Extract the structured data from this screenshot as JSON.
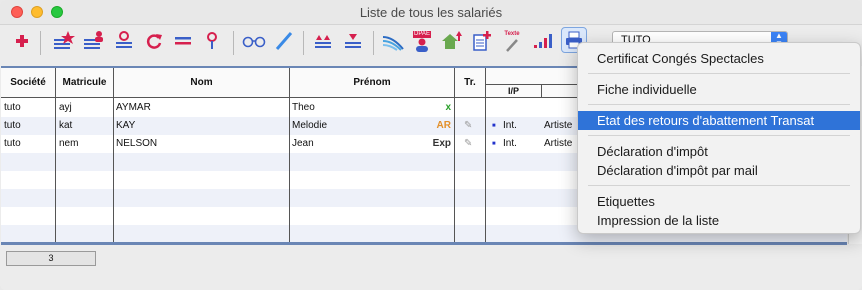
{
  "window": {
    "title": "Liste de tous les salariés"
  },
  "toolbar": {
    "company_select": "TUTO",
    "dpae_badge": "DPAE",
    "texte_badge": "Texte",
    "icons": [
      "add-icon",
      "add-star-list-icon",
      "add-person-list-icon",
      "tree-person-icon",
      "refresh-icon",
      "equal-lines-icon",
      "search-key-icon",
      "glasses-icon",
      "pen-icon",
      "sort-up-icon",
      "sort-down-icon",
      "swoosh-icon",
      "dpae-person-icon",
      "home-up-icon",
      "doc-plus-icon",
      "text-pen-icon",
      "bars-icon",
      "print-icon"
    ]
  },
  "table": {
    "headers": {
      "societe": "Société",
      "matricule": "Matricule",
      "nom": "Nom",
      "prenom": "Prénom",
      "tr": "Tr.",
      "ip": "I/P"
    },
    "rows": [
      {
        "societe": "tuto",
        "matricule": "ayj",
        "nom": "AYMAR",
        "prenom": "Theo",
        "tag": "x",
        "tag_color": "#2aa02a",
        "edit": "",
        "ip": "",
        "statut": ""
      },
      {
        "societe": "tuto",
        "matricule": "kat",
        "nom": "KAY",
        "prenom": "Melodie",
        "tag": "AR",
        "tag_color": "#e3902a",
        "edit": "✎",
        "ip": "Int.",
        "statut": "Artiste"
      },
      {
        "societe": "tuto",
        "matricule": "nem",
        "nom": "NELSON",
        "prenom": "Jean",
        "tag": "Exp",
        "tag_color": "#333333",
        "edit": "✎",
        "ip": "Int.",
        "statut": "Artiste"
      }
    ]
  },
  "footer": {
    "count": "3"
  },
  "menu": {
    "items": [
      {
        "label": "Certificat Congés Spectacles"
      },
      {
        "label": "Fiche individuelle"
      },
      {
        "label": "Etat des retours d'abattement Transat",
        "selected": true
      },
      {
        "label": "Déclaration d'impôt"
      },
      {
        "label": "Déclaration d'impôt par mail"
      },
      {
        "label": "Etiquettes"
      },
      {
        "label": "Impression de la liste"
      }
    ]
  },
  "colors": {
    "accent": "#2f73d8",
    "header_border": "#6a86b5",
    "icon_red": "#d6204e",
    "icon_blue": "#3a5fc8"
  }
}
